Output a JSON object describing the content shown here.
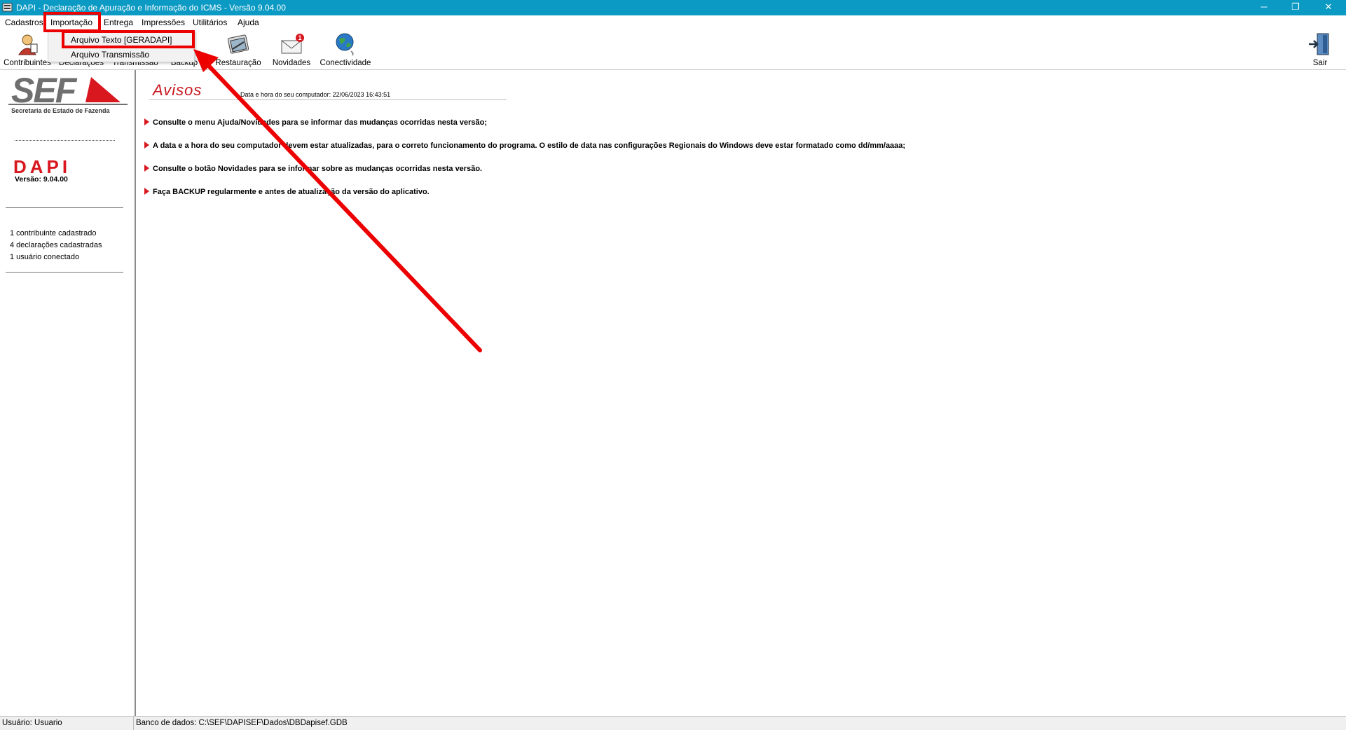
{
  "window": {
    "title": "DAPI - Declaração de Apuração e Informação do ICMS - Versão 9.04.00",
    "minimize_glyph": "─",
    "restore_glyph": "❐",
    "close_glyph": "✕"
  },
  "menu": {
    "items": [
      "Cadastros",
      "Importação",
      "Entrega",
      "Impressões",
      "Utilitários",
      "Ajuda"
    ],
    "active": "Importação"
  },
  "dropdown": {
    "items": [
      "Arquivo Texto [GERADAPI]",
      "Arquivo Transmissão"
    ]
  },
  "toolbar": {
    "buttons": [
      {
        "label": "Contribuintes",
        "icon": "contribuintes-icon"
      },
      {
        "label": "Declarações",
        "icon": "declaracoes-icon"
      },
      {
        "label": "Transmissão",
        "icon": "transmissao-icon"
      },
      {
        "label": "Backup",
        "icon": "backup-icon"
      },
      {
        "label": "Restauração",
        "icon": "restauracao-icon"
      },
      {
        "label": "Novidades",
        "icon": "envelope-icon",
        "badge": "1"
      },
      {
        "label": "Conectividade",
        "icon": "globe-icon"
      }
    ],
    "exit_label": "Sair"
  },
  "sidebar": {
    "logo_text": "SEF",
    "logo_subtitle": "Secretaria de Estado de Fazenda",
    "app_name": "DAPI",
    "version": "Versão: 9.04.00",
    "stats": [
      "1 contribuinte cadastrado",
      "4 declarações cadastradas",
      "1 usuário conectado"
    ]
  },
  "main": {
    "title": "Avisos",
    "datetime": "Data e hora do seu computador: 22/06/2023 16:43:51",
    "notices": [
      "Consulte o menu Ajuda/Novidades para se informar das mudanças ocorridas nesta versão;",
      "A data e a hora do seu computador devem estar atualizadas, para o correto funcionamento do programa. O estilo de data nas configurações Regionais do Windows deve estar formatado como dd/mm/aaaa;",
      "Consulte o botão Novidades para se informar sobre as mudanças ocorridas nesta versão.",
      "Faça BACKUP regularmente e antes de atualização da versão do aplicativo."
    ]
  },
  "status": {
    "user": "Usuário: Usuario",
    "database": "Banco de dados: C:\\SEF\\DAPISEF\\Dados\\DBDapisef.GDB"
  },
  "colors": {
    "titlebar": "#0b9ac4",
    "annotation_red": "#ec0000",
    "brand_red": "#d8171f"
  }
}
